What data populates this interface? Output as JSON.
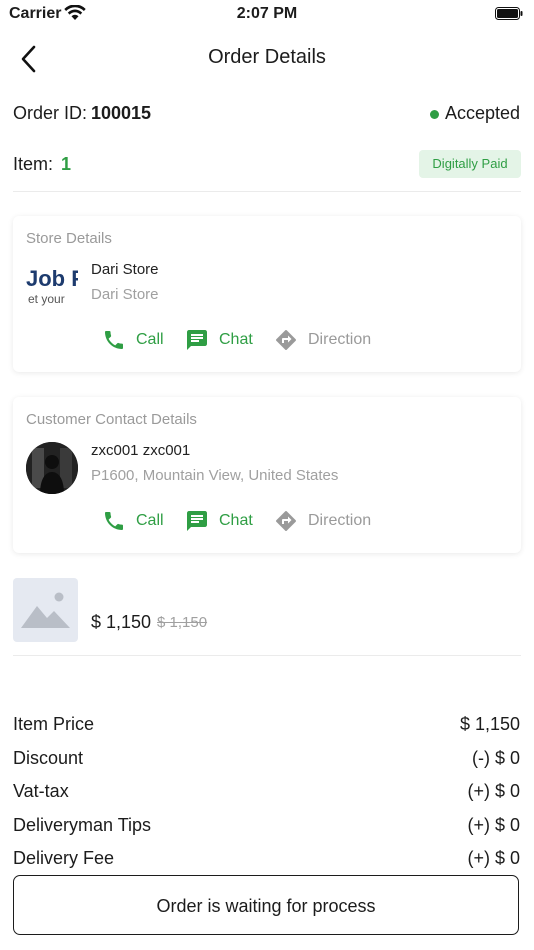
{
  "status_bar": {
    "carrier": "Carrier",
    "time": "2:07 PM"
  },
  "header": {
    "title": "Order Details"
  },
  "order": {
    "id_label": "Order ID:",
    "id_value": "100015",
    "status": "Accepted",
    "item_label": "Item:",
    "item_count": "1",
    "payment_badge": "Digitally Paid"
  },
  "store": {
    "section_title": "Store Details",
    "logo_text_main": "Job F",
    "logo_text_sub": "et your",
    "name": "Dari Store",
    "address": "Dari Store",
    "actions": {
      "call": "Call",
      "chat": "Chat",
      "direction": "Direction"
    }
  },
  "customer": {
    "section_title": "Customer Contact Details",
    "name": "zxc001 zxc001",
    "address": "P1600, Mountain View, United States",
    "actions": {
      "call": "Call",
      "chat": "Chat",
      "direction": "Direction"
    }
  },
  "product": {
    "price": "$ 1,150",
    "original_price": "$ 1,150",
    "image_icon": "image-placeholder-icon"
  },
  "summary": {
    "item_price_label": "Item Price",
    "item_price_value": "$ 1,150",
    "discount_label": "Discount",
    "discount_value": "(-) $ 0",
    "vat_label": "Vat-tax",
    "vat_value": "(+) $ 0",
    "tips_label": "Deliveryman Tips",
    "tips_value": "(+) $ 0",
    "delivery_label": "Delivery Fee",
    "delivery_value": "(+) $ 0"
  },
  "footer": {
    "process_button": "Order is waiting for process"
  },
  "colors": {
    "accent": "#2f9e44",
    "muted": "#9a9a9a",
    "badge_bg": "#e4f4e7"
  }
}
